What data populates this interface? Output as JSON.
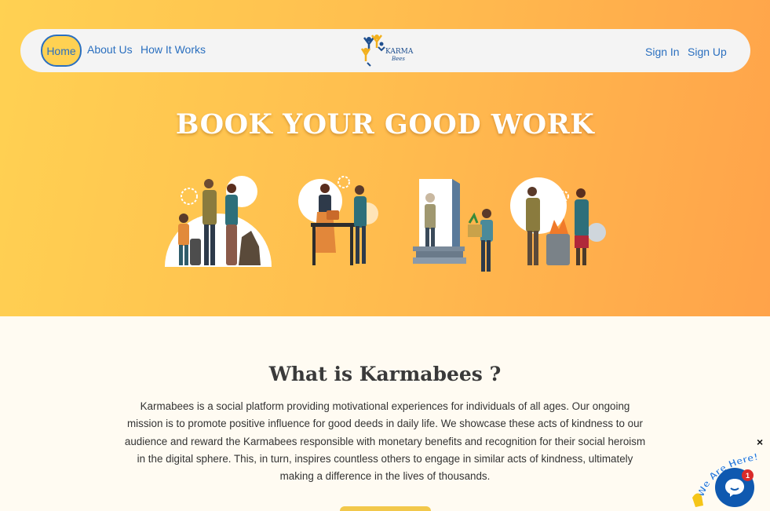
{
  "nav": {
    "home": "Home",
    "about": "About Us",
    "how": "How It Works",
    "signin": "Sign In",
    "signup": "Sign Up",
    "logo_text": "KARMA",
    "logo_sub": "Bees"
  },
  "hero": {
    "title": "BOOK YOUR GOOD WORK"
  },
  "about": {
    "title": "What is Karmabees ?",
    "text": "Karmabees is a social platform providing motivational experiences for individuals of all ages. Our ongoing mission is to promote positive influence for good deeds in daily life. We showcase these acts of kindness to our audience and reward the Karmabees responsible with monetary benefits and recognition for their social heroism in the digital sphere. This, in turn, inspires countless others to engage in similar acts of kindness, ultimately making a difference in the lives of thousands."
  },
  "chat": {
    "close": "×",
    "label": "We Are Here!",
    "badge": "1"
  },
  "colors": {
    "accent": "#2a6fbf",
    "hero_start": "#ffd152",
    "hero_end": "#ffa34a",
    "chat": "#0f59b0",
    "badge": "#d92b2b"
  }
}
